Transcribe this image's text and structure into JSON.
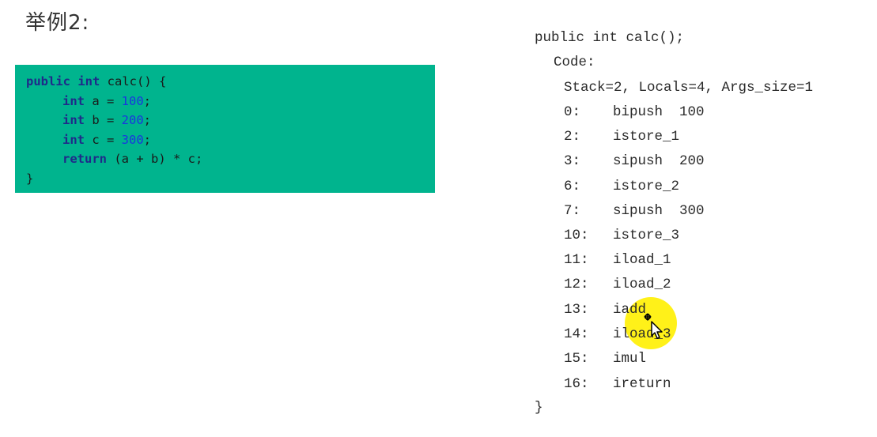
{
  "title": "举例2:",
  "java_source": {
    "line1": {
      "kw1": "public",
      "kw2": "int",
      "rest": " calc() {"
    },
    "line2": {
      "kw": "int",
      "var": " a = ",
      "num": "100",
      "end": ";"
    },
    "line3": {
      "kw": "int",
      "var": " b = ",
      "num": "200",
      "end": ";"
    },
    "line4": {
      "kw": "int",
      "var": " c = ",
      "num": "300",
      "end": ";"
    },
    "line5": {
      "kw": "return",
      "rest": " (a + b) * c;"
    },
    "line6": "}"
  },
  "bytecode": {
    "signature": "public int calc();",
    "code_label": "Code:",
    "stack_info": "Stack=2, Locals=4, Args_size=1",
    "instructions": [
      {
        "offset": "0:",
        "op": "bipush  100"
      },
      {
        "offset": "2:",
        "op": "istore_1"
      },
      {
        "offset": "3:",
        "op": "sipush  200"
      },
      {
        "offset": "6:",
        "op": "istore_2"
      },
      {
        "offset": "7:",
        "op": "sipush  300"
      },
      {
        "offset": "10:",
        "op": "istore_3"
      },
      {
        "offset": "11:",
        "op": "iload_1"
      },
      {
        "offset": "12:",
        "op": "iload_2"
      },
      {
        "offset": "13:",
        "op": "iadd"
      },
      {
        "offset": "14:",
        "op": "iload_3"
      },
      {
        "offset": "15:",
        "op": "imul"
      },
      {
        "offset": "16:",
        "op": "ireturn"
      }
    ],
    "closing": "}"
  },
  "colors": {
    "code_box_bg": "#00b48e",
    "keyword": "#1f2a8a",
    "number": "#1a35e0",
    "highlight": "#fff000"
  },
  "cursor": {
    "icon": "move-cursor-icon"
  }
}
